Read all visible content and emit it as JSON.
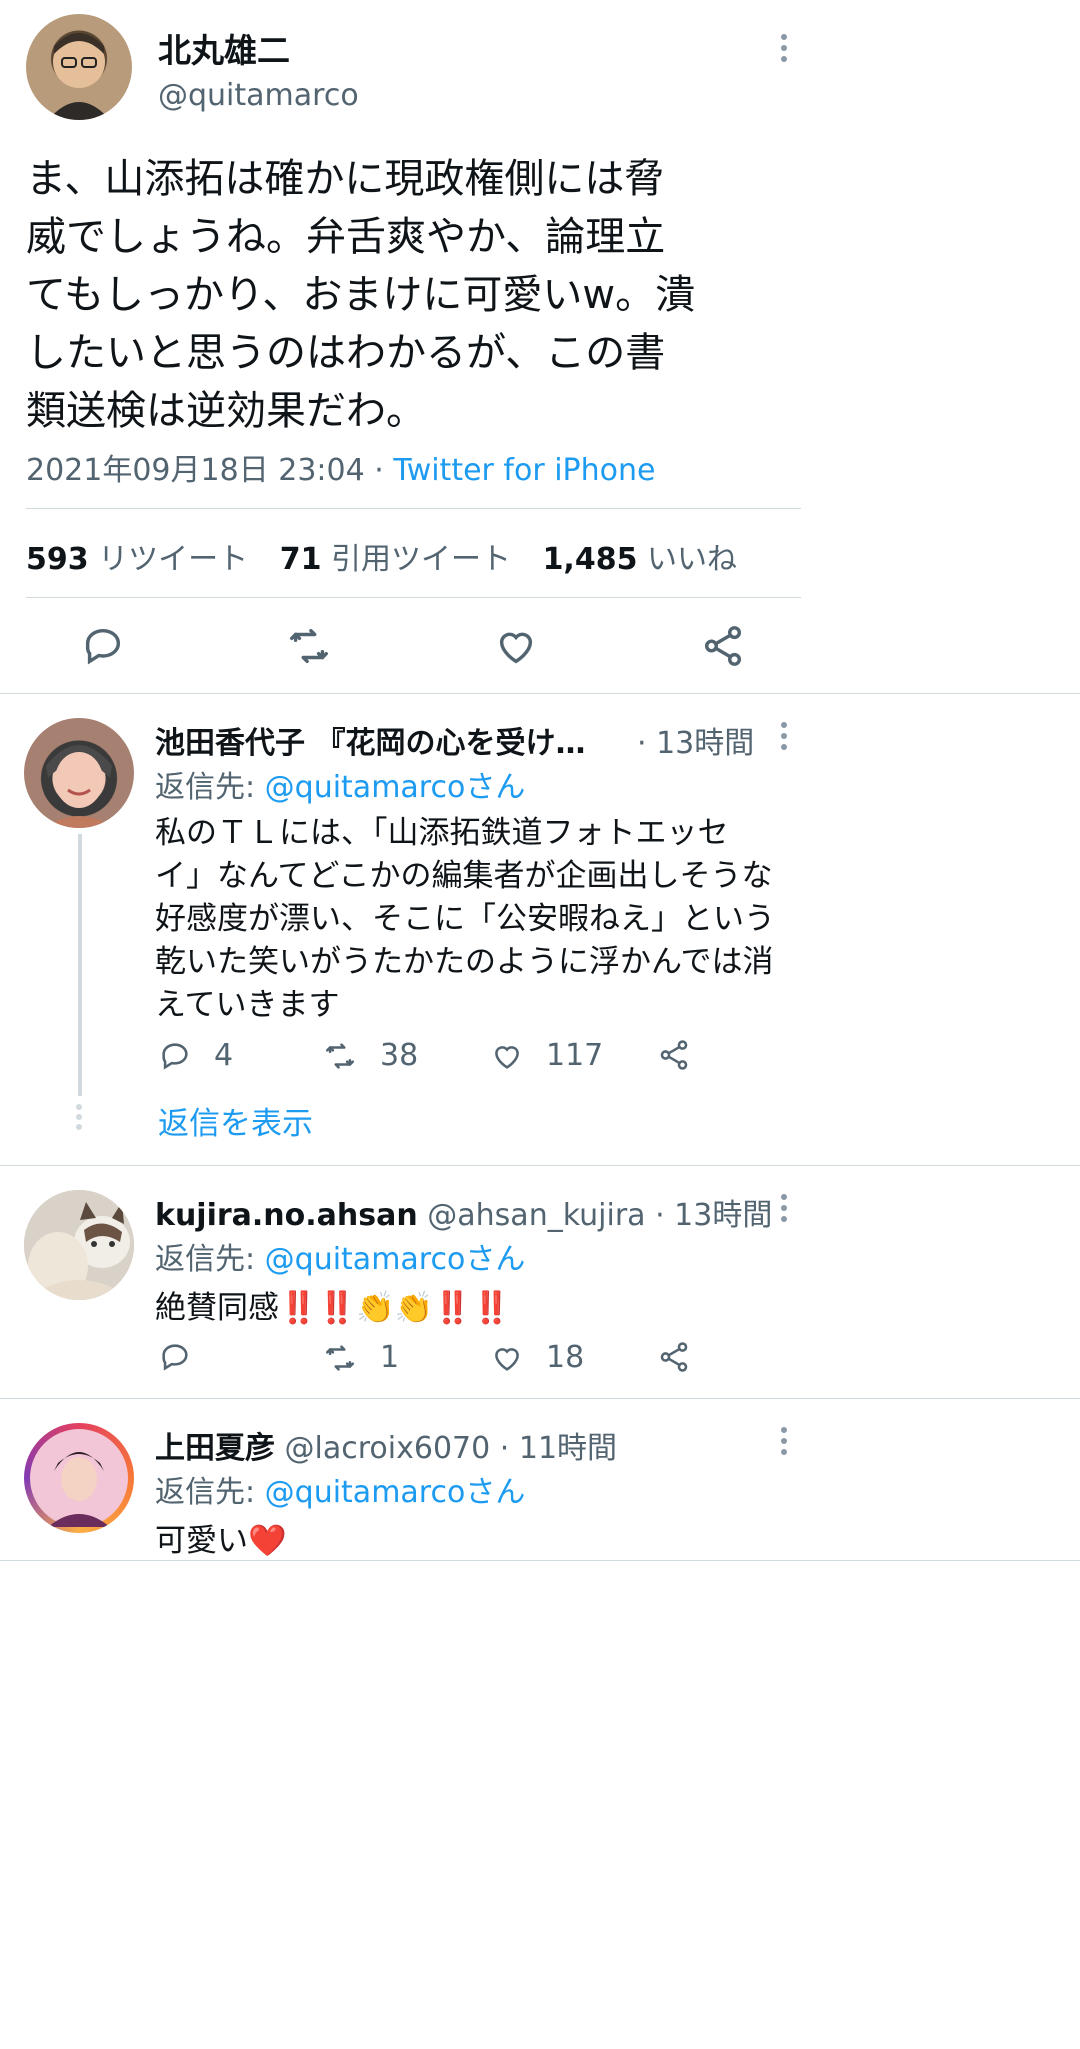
{
  "main_tweet": {
    "author_name": "北丸雄二",
    "handle": "@quitamarco",
    "text_lines": [
      "ま、山添拓は確かに現政権側には脅",
      "威でしょうね。弁舌爽やか、論理立",
      "てもしっかり、おまけに可愛いw。潰",
      "したいと思うのはわかるが、この書",
      "類送検は逆効果だわ。"
    ],
    "timestamp": "2021年09月18日 23:04",
    "separator": "·",
    "source": "Twitter for iPhone",
    "stats": {
      "retweets_count": "593",
      "retweets_label": "リツイート",
      "quotes_count": "71",
      "quotes_label": "引用ツイート",
      "likes_count": "1,485",
      "likes_label": "いいね"
    },
    "icons": [
      "reply-icon",
      "retweet-icon",
      "like-icon",
      "share-icon"
    ]
  },
  "replies": [
    {
      "author_name": "池田香代子 『花岡の心を受け…",
      "handle": "",
      "time": "· 13時間",
      "reply_to_label": "返信先:",
      "reply_to_handle": "@quitamarcoさん",
      "text_lines": [
        "私のＴＬには、「山添拓鉄道フォトエッセ",
        "イ」なんてどこかの編集者が企画出しそうな",
        "好感度が漂い、そこに「公安暇ねえ」という",
        "乾いた笑いがうたかたのように浮かんでは消",
        "えていきます"
      ],
      "reply_count": "4",
      "retweet_count": "38",
      "like_count": "117",
      "show_replies": "返信を表示"
    },
    {
      "author_name": "kujira.no.ahsan",
      "handle": "@ahsan_kujira",
      "time": "· 13時間",
      "reply_to_label": "返信先:",
      "reply_to_handle": "@quitamarcoさん",
      "text": "絶賛同感",
      "emoji": "‼️‼️👏👏‼️‼️",
      "reply_count": "",
      "retweet_count": "1",
      "like_count": "18"
    },
    {
      "author_name": "上田夏彦",
      "handle": "@lacroix6070",
      "time": "· 11時間",
      "reply_to_label": "返信先:",
      "reply_to_handle": "@quitamarcoさん",
      "text": "可愛い",
      "emoji": "❤️"
    }
  ],
  "colors": {
    "link_blue": "#1d9bf0",
    "muted_gray": "#536471",
    "text_dark": "#0f1419",
    "divider": "#cfd9de",
    "heart_red": "#e0245e"
  }
}
